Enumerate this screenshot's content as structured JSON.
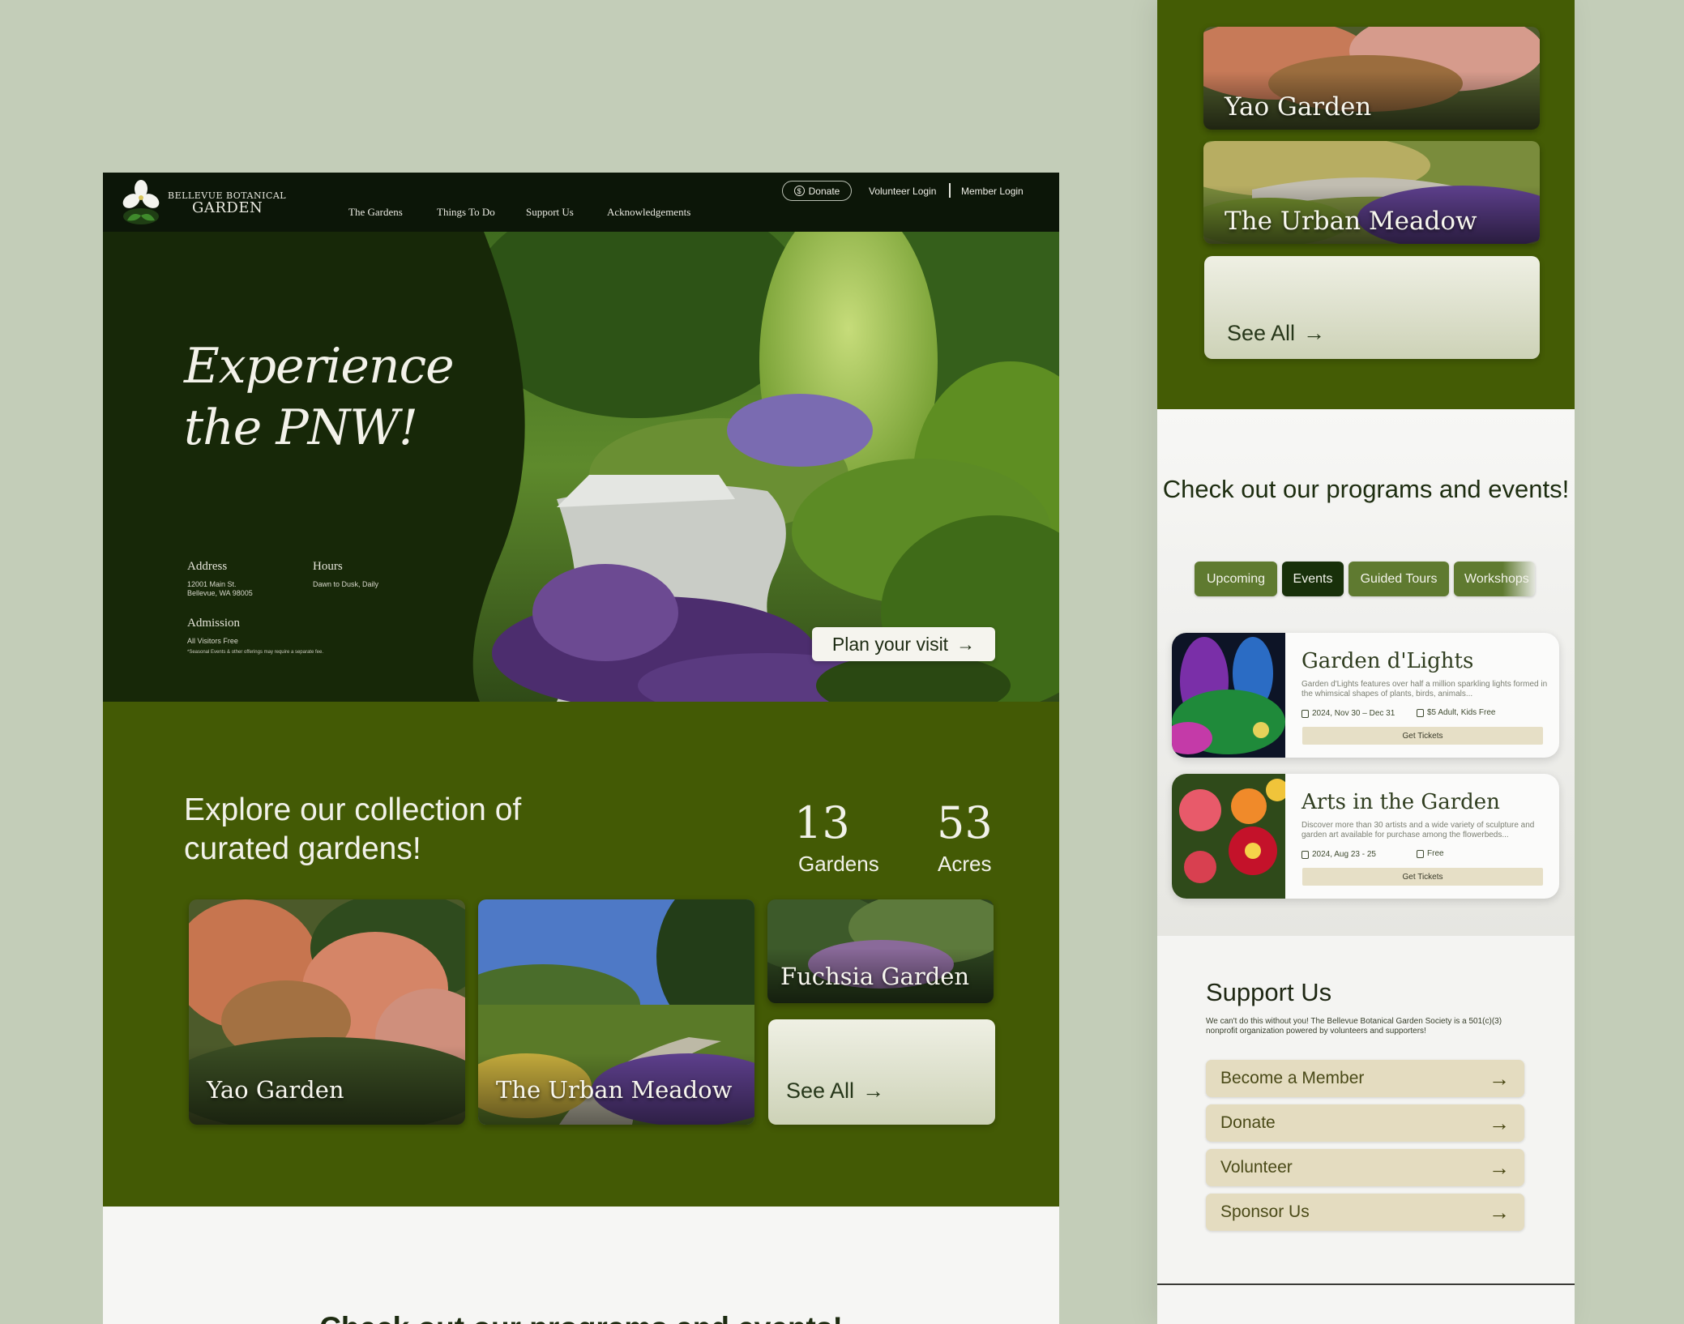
{
  "desktop": {
    "nav": {
      "logo_top": "Bellevue Botanical",
      "logo_bottom": "Garden",
      "links": [
        "The Gardens",
        "Things To Do",
        "Support Us",
        "Acknowledgements"
      ],
      "donate": "Donate",
      "donate_icon": "dollar-coin-icon",
      "volunteer_login": "Volunteer Login",
      "member_login": "Member Login"
    },
    "hero": {
      "title_line1": "Experience",
      "title_line2": "the PNW!",
      "address_label": "Address",
      "address_line1": "12001 Main St.",
      "address_line2": "Bellevue, WA 98005",
      "hours_label": "Hours",
      "hours_value": "Dawn to Dusk, Daily",
      "admission_label": "Admission",
      "admission_value": "All Visitors Free",
      "admission_note": "*Seasonal Events & other offerings may require a separate fee.",
      "plan_button": "Plan your visit"
    },
    "collection": {
      "heading": "Explore our collection of curated gardens!",
      "stats": [
        {
          "value": "13",
          "label": "Gardens"
        },
        {
          "value": "53",
          "label": "Acres"
        }
      ],
      "cards": [
        "Yao Garden",
        "The Urban Meadow",
        "Fuchsia Garden"
      ],
      "see_all": "See All"
    },
    "events_heading": "Check out our programs and events!"
  },
  "mobile": {
    "garden_cards": [
      "Yao Garden",
      "The Urban Meadow"
    ],
    "see_all": "See All",
    "events": {
      "heading": "Check out our programs and events!",
      "tabs": [
        "Upcoming",
        "Events",
        "Guided Tours",
        "Workshops"
      ],
      "active_tab": "Events",
      "items": [
        {
          "title": "Garden d'Lights",
          "description": "Garden d'Lights features over half a million sparkling lights formed in the whimsical shapes of plants, birds, animals...",
          "dates": "2024, Nov 30 – Dec 31",
          "price": "$5 Adult, Kids Free",
          "button": "Get Tickets"
        },
        {
          "title": "Arts in the Garden",
          "description": "Discover more than 30 artists and a wide variety of sculpture and garden art available for purchase among the flowerbeds...",
          "dates": "2024, Aug 23 - 25",
          "price": "Free",
          "button": "Get Tickets"
        }
      ]
    },
    "support": {
      "heading": "Support Us",
      "text": "We can't do this without you! The Bellevue Botanical Garden Society is a 501(c)(3) nonprofit organization powered by volunteers and supporters!",
      "buttons": [
        "Become a Member",
        "Donate",
        "Volunteer",
        "Sponsor Us"
      ]
    }
  },
  "colors": {
    "page_bg": "#c3cdb8",
    "nav_bg": "#0c1608",
    "hero_dark": "#172808",
    "olive": "#435a05",
    "cream_button": "#e4dcc0",
    "active_tab": "#18300a",
    "inactive_tab": "#5f7a30"
  }
}
